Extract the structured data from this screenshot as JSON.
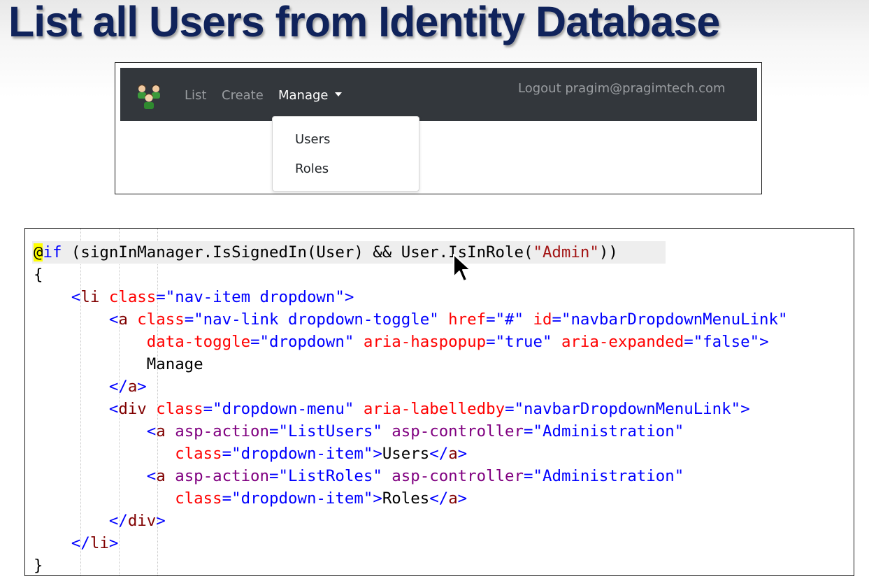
{
  "slide": {
    "title": "List all Users from Identity Database"
  },
  "navbar": {
    "logo_icon": "users-group-icon",
    "links": {
      "list": "List",
      "create": "Create",
      "manage": "Manage"
    },
    "logout": "Logout pragim@pragimtech.com",
    "dropdown": {
      "users": "Users",
      "roles": "Roles"
    }
  },
  "code": {
    "l1": {
      "at": "@",
      "kw": "if",
      "t1": " (signInManager.IsSignedIn(User) && User.IsInRole(",
      "s1": "\"Admin\"",
      "t2": "))"
    },
    "l2": {
      "t": "{"
    },
    "l3": {
      "indent": "    ",
      "lt": "<",
      "tag": "li",
      "sp": " ",
      "a1": "class",
      "eq": "=",
      "v1": "\"nav-item dropdown\"",
      "gt": ">"
    },
    "l4": {
      "indent": "        ",
      "lt": "<",
      "tag": "a",
      "sp1": " ",
      "a1": "class",
      "eq1": "=",
      "v1": "\"nav-link dropdown-toggle\"",
      "sp2": " ",
      "a2": "href",
      "eq2": "=",
      "v2": "\"#\"",
      "sp3": " ",
      "a3": "id",
      "eq3": "=",
      "v3": "\"navbarDropdownMenuLink\""
    },
    "l5": {
      "indent": "            ",
      "a1": "data-toggle",
      "eq1": "=",
      "v1": "\"dropdown\"",
      "sp2": " ",
      "a2": "aria-haspopup",
      "eq2": "=",
      "v2": "\"true\"",
      "sp3": " ",
      "a3": "aria-expanded",
      "eq3": "=",
      "v3": "\"false\"",
      "gt": ">"
    },
    "l6": {
      "indent": "            ",
      "t": "Manage"
    },
    "l7": {
      "indent": "        ",
      "lt": "</",
      "tag": "a",
      "gt": ">"
    },
    "l8": {
      "indent": "        ",
      "lt": "<",
      "tag": "div",
      "sp1": " ",
      "a1": "class",
      "eq1": "=",
      "v1": "\"dropdown-menu\"",
      "sp2": " ",
      "a2": "aria-labelledby",
      "eq2": "=",
      "v2": "\"navbarDropdownMenuLink\"",
      "gt": ">"
    },
    "l9": {
      "indent": "            ",
      "lt": "<",
      "tag": "a",
      "sp1": " ",
      "a1": "asp-action",
      "eq1": "=",
      "v1": "\"ListUsers\"",
      "sp2": " ",
      "a2": "asp-controller",
      "eq2": "=",
      "v2": "\"Administration\""
    },
    "l10": {
      "indent": "               ",
      "a1": "class",
      "eq1": "=",
      "v1": "\"dropdown-item\"",
      "gt": ">",
      "t": "Users",
      "lt2": "</",
      "tag2": "a",
      "gt2": ">"
    },
    "l11": {
      "indent": "            ",
      "lt": "<",
      "tag": "a",
      "sp1": " ",
      "a1": "asp-action",
      "eq1": "=",
      "v1": "\"ListRoles\"",
      "sp2": " ",
      "a2": "asp-controller",
      "eq2": "=",
      "v2": "\"Administration\""
    },
    "l12": {
      "indent": "               ",
      "a1": "class",
      "eq1": "=",
      "v1": "\"dropdown-item\"",
      "gt": ">",
      "t": "Roles",
      "lt2": "</",
      "tag2": "a",
      "gt2": ">"
    },
    "l13": {
      "indent": "        ",
      "lt": "</",
      "tag": "div",
      "gt": ">"
    },
    "l14": {
      "indent": "    ",
      "lt": "</",
      "tag": "li",
      "gt": ">"
    },
    "l15": {
      "t": "}"
    }
  },
  "colors": {
    "title": "#10235b",
    "navbar_bg": "#33373c",
    "tag": "#800000",
    "attribute": "#ff0000",
    "value": "#0000ff",
    "tag_helper": "#800080",
    "string": "#a31515"
  }
}
